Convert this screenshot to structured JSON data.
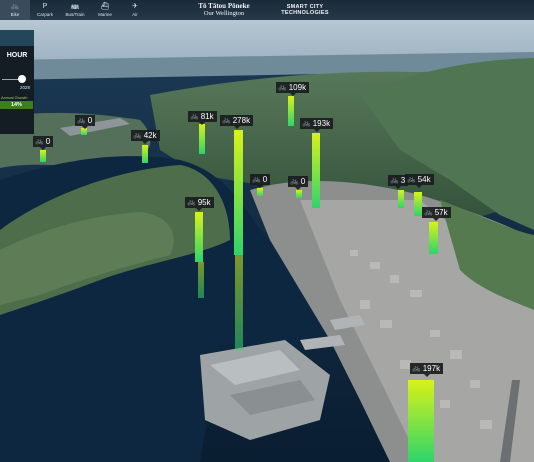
{
  "app": {
    "title_line1": "Tō Tātou Pōneke",
    "title_line2": "Our Wellington",
    "subtitle_line1": "SMART CITY",
    "subtitle_line2": "TECHNOLOGIES"
  },
  "nav": [
    {
      "label": "Bike",
      "icon": "bicycle-icon",
      "glyph": "🚲",
      "active": true
    },
    {
      "label": "Carpark",
      "icon": "parking-icon",
      "glyph": "P",
      "active": false
    },
    {
      "label": "Bus/Train",
      "icon": "bus-icon",
      "glyph": "🚌",
      "active": false
    },
    {
      "label": "Marine",
      "icon": "ferry-icon",
      "glyph": "⛴",
      "active": false
    },
    {
      "label": "Air",
      "icon": "airplane-icon",
      "glyph": "✈",
      "active": false
    }
  ],
  "panel": {
    "title": "HOUR",
    "year": "2028",
    "growth_label": "Annual Growth",
    "growth_value": "14%",
    "slider_fraction": 0.85
  },
  "counters": [
    {
      "value": "0",
      "bike_icon": "🚲"
    },
    {
      "value": "0",
      "bike_icon": "🚲"
    },
    {
      "value": "42k",
      "bike_icon": "🚲"
    },
    {
      "value": "81k",
      "bike_icon": "🚲"
    },
    {
      "value": "278k",
      "bike_icon": "🚲"
    },
    {
      "value": "109k",
      "bike_icon": "🚲"
    },
    {
      "value": "193k",
      "bike_icon": "🚲"
    },
    {
      "value": "95k",
      "bike_icon": "🚲"
    },
    {
      "value": "0",
      "bike_icon": "🚲"
    },
    {
      "value": "0",
      "bike_icon": "🚲"
    },
    {
      "value": "3",
      "bike_icon": "🚲"
    },
    {
      "value": "54k",
      "bike_icon": "🚲"
    },
    {
      "value": "57k",
      "bike_icon": "🚲"
    },
    {
      "value": "197k",
      "bike_icon": "🚲"
    }
  ],
  "colors": {
    "bar_top": "#d8f21a",
    "bar_bottom": "#2fd46a",
    "growth": "#3c7d1c",
    "water": "#0e2740"
  }
}
